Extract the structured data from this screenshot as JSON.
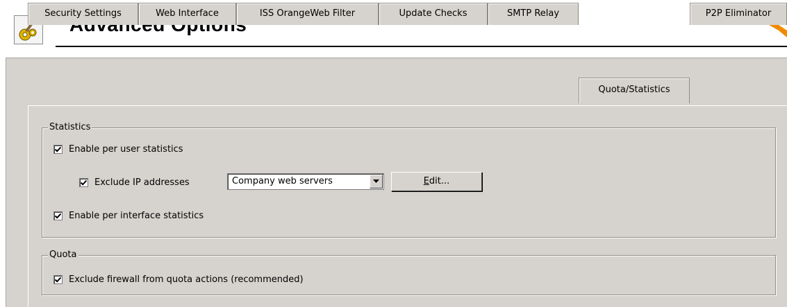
{
  "header": {
    "title": "Advanced Options",
    "icon": "gear-hammer-icon",
    "brand_icon": "orange-brand-mark-icon",
    "brand_color": "#f28a00"
  },
  "tabs": [
    {
      "label": "Security Settings",
      "active": false
    },
    {
      "label": "Web Interface",
      "active": false
    },
    {
      "label": "ISS OrangeWeb Filter",
      "active": false
    },
    {
      "label": "Update Checks",
      "active": false
    },
    {
      "label": "SMTP Relay",
      "active": false
    },
    {
      "label": "Quota/Statistics",
      "active": true
    },
    {
      "label": "P2P Eliminator",
      "active": false
    }
  ],
  "statistics": {
    "group_label": "Statistics",
    "per_user": {
      "label": "Enable per user statistics",
      "checked": true
    },
    "exclude_ip": {
      "label": "Exclude IP addresses",
      "checked": true
    },
    "exclude_select_value": "Company web servers",
    "edit_button_access": "E",
    "edit_button_rest": "dit...",
    "per_interface": {
      "label": "Enable per interface statistics",
      "checked": true
    }
  },
  "quota": {
    "group_label": "Quota",
    "exclude_firewall": {
      "label": "Exclude firewall from quota actions (recommended)",
      "checked": true
    }
  },
  "colors": {
    "panel_bg": "#d6d3ce",
    "page_bg": "#ffffff"
  }
}
